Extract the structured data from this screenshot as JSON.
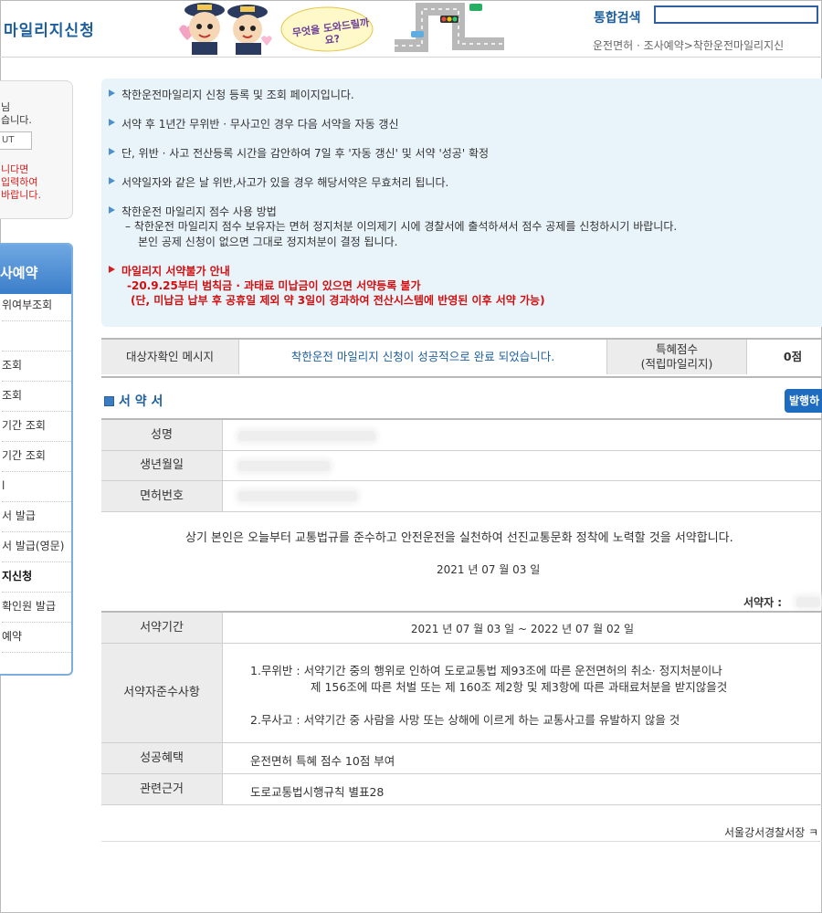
{
  "header": {
    "page_title": "마일리지신청",
    "mascot_caption": "무엇을 도와드릴까요?",
    "search_label": "통합검색",
    "search_value": "",
    "breadcrumb": "운전면허 · 조사예약>착한운전마일리지신"
  },
  "login": {
    "line1": "님",
    "line2": "습니다.",
    "logout_label": "UT",
    "notice1": "니다면",
    "notice2": "입력하여",
    "notice3": "바랍니다."
  },
  "side_menu": {
    "title": "사예약",
    "items": [
      {
        "label": "위여부조회"
      },
      {
        "label": ""
      },
      {
        "label": "조회"
      },
      {
        "label": "조회"
      },
      {
        "label": "기간 조회"
      },
      {
        "label": "기간 조회"
      },
      {
        "label": "l"
      },
      {
        "label": "서 발급"
      },
      {
        "label": "서 발급(영문)"
      },
      {
        "label": "지신청"
      },
      {
        "label": "확인원 발급"
      },
      {
        "label": "예약"
      }
    ]
  },
  "info": {
    "line1": "착한운전마일리지 신청 등록 및 조회 페이지입니다.",
    "line2": "서약 후 1년간 무위반 · 무사고인 경우 다음 서약을 자동 갱신",
    "line3": "단, 위반 · 사고 전산등록 시간을 감안하여 7일 후 '자동 갱신' 및 서약 '성공' 확정",
    "line4": "서약일자와 같은 날 위반,사고가 있을 경우 해당서약은 무효처리 됩니다.",
    "line5": "착한운전 마일리지 점수 사용 방법",
    "line5_sub1": "– 착한운전 마일리지 점수 보유자는 면허 정지처분 이의제기 시에 경찰서에 출석하셔서 점수 공제를 신청하시기 바랍니다.",
    "line5_sub2": "본인 공제 신청이 없으면 그대로 정지처분이 결정 됩니다.",
    "warn_title": "마일리지 서약불가 안내",
    "warn_line1": "-20.9.25부터 범칙금 · 과태료 미납금이 있으면 서약등록 불가",
    "warn_line2": "(단, 미납금 납부 후 공휴일 제외 약 3일이 경과하여 전산시스템에 반영된 이후 서약 가능)"
  },
  "result": {
    "label": "대상자확인 메시지",
    "message": "착한운전 마일리지 신청이 성공적으로 완료 되었습니다.",
    "points_label_1": "특혜점수",
    "points_label_2": "(적립마일리지)",
    "points_value": "0점"
  },
  "pledge": {
    "section_title": "서 약 서",
    "print_label": "발행하",
    "name_label": "성명",
    "birth_label": "생년월일",
    "license_label": "면허번호",
    "statement": "상기 본인은 오늘부터 교통법규를 준수하고 안전운전을 실천하여 선진교통문화 정착에 노력할 것을 서약합니다.",
    "date": "2021 년 07 월 03 일",
    "pledger_label": "서약자 :",
    "period_label": "서약기간",
    "period_value": "2021 년 07 월 03 일 ~ 2022 년 07 월 02 일",
    "rules_label": "서약자준수사항",
    "rule1_a": "1.무위반 : 서약기간 중의 행위로 인하여 도로교통법 제93조에 따른 운전면허의 취소· 정지처분이나",
    "rule1_b": "제 156조에 따른 처벌 또는 제 160조 제2항 및 제3항에 따른 과태료처분을 받지않을것",
    "rule2": "2.무사고 : 서약기간 중 사람을 사망 또는 상해에 이르게 하는 교통사고를 유발하지 않을 것",
    "benefit_label": "성공혜택",
    "benefit_value": "운전면허 특혜 점수 10점 부여",
    "basis_label": "관련근거",
    "basis_value": "도로교통법시행규칙 별표28",
    "footer_sign": "서울강서경찰서장 ㅋ"
  }
}
